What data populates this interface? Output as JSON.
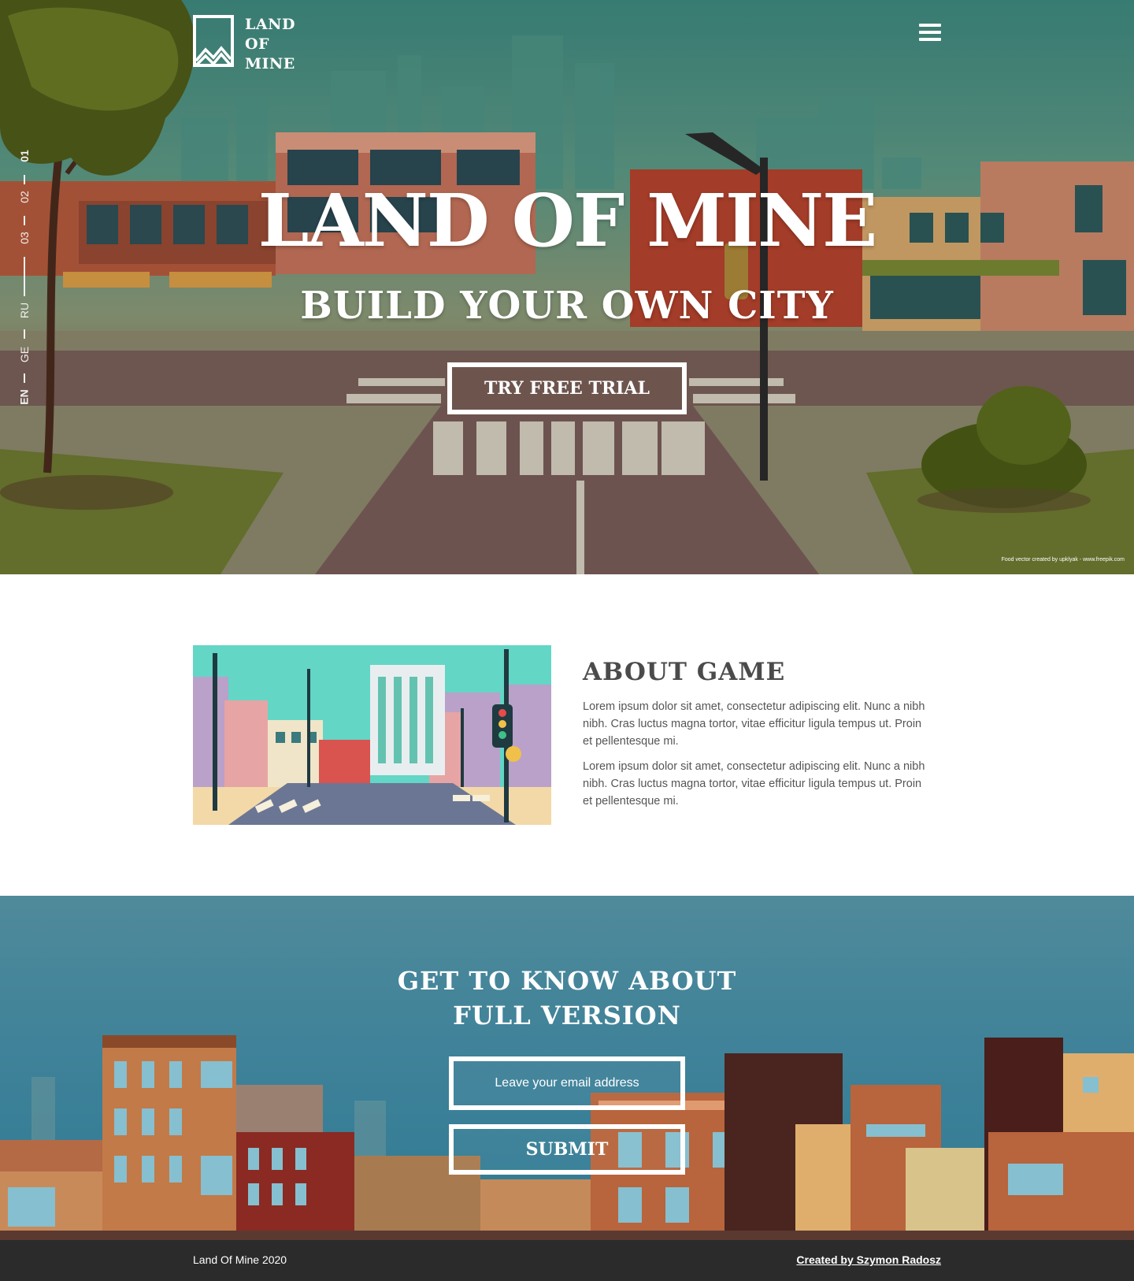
{
  "header": {
    "logo_lines": [
      "LAND",
      "OF",
      "MINE"
    ],
    "menu_icon": "hamburger-menu-icon"
  },
  "side_nav": {
    "sections": [
      "01",
      "02",
      "03"
    ],
    "languages": [
      "RU",
      "GE",
      "EN"
    ]
  },
  "hero": {
    "title": "LAND OF MINE",
    "subtitle": "BUILD YOUR OWN CITY",
    "cta_label": "TRY FREE TRIAL",
    "credit": "Food vector created by upklyak - www.freepik.com"
  },
  "about": {
    "title": "ABOUT GAME",
    "paragraphs": [
      "Lorem ipsum dolor sit amet, consectetur adipiscing elit. Nunc a nibh nibh. Cras luctus magna tortor, vitae efficitur ligula tempus ut. Proin et pellentesque mi.",
      "Lorem ipsum dolor sit amet, consectetur adipiscing elit. Nunc a nibh nibh. Cras luctus magna tortor, vitae efficitur ligula tempus ut. Proin et pellentesque mi."
    ]
  },
  "signup": {
    "title_line1": "GET TO KNOW ABOUT",
    "title_line2": "FULL VERSION",
    "email_placeholder": "Leave your email address",
    "submit_label": "SUBMIT"
  },
  "footer": {
    "copyright": "Land Of Mine 2020",
    "author_link": "Created by Szymon Radosz"
  }
}
